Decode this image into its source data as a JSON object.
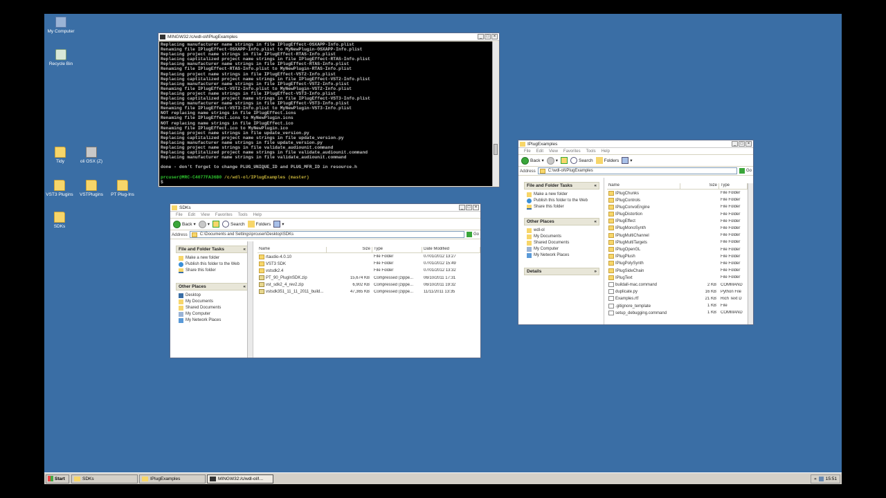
{
  "desktop": {
    "icons": [
      {
        "label": "My Computer",
        "icon": "computer-icon"
      },
      {
        "label": "Recycle Bin",
        "icon": "recycle-bin-icon"
      },
      {
        "label": "Tidy",
        "icon": "folder-icon"
      },
      {
        "label": "oli OSX (Z)",
        "icon": "network-drive-icon"
      },
      {
        "label": "VST3 Plugins",
        "icon": "folder-icon"
      },
      {
        "label": "VSTPlugins",
        "icon": "folder-icon"
      },
      {
        "label": "PT Plug-Ins",
        "icon": "folder-icon"
      },
      {
        "label": "SDKs",
        "icon": "folder-icon"
      }
    ]
  },
  "console": {
    "title": "MINGW32:/c/wdl-ol/IPlugExamples",
    "lines": [
      "Replacing manufacturer name strings in file IPlugEffect-OSXAPP-Info.plist",
      "Renaming file IPlugEffect-OSXAPP-Info.plist to MyNewPlugin-OSXAPP-Info.plist",
      "Replacing project name strings in file IPlugEffect-RTAS-Info.plist",
      "Replacing captitalized project name strings in file IPlugEffect-RTAS-Info.plist",
      "Replacing manufacturer name strings in file IPlugEffect-RTAS-Info.plist",
      "Renaming file IPlugEffect-RTAS-Info.plist to MyNewPlugin-RTAS-Info.plist",
      "Replacing project name strings in file IPlugEffect-VST2-Info.plist",
      "Replacing captitalized project name strings in file IPlugEffect-VST2-Info.plist",
      "Replacing manufacturer name strings in file IPlugEffect-VST2-Info.plist",
      "Renaming file IPlugEffect-VST2-Info.plist to MyNewPlugin-VST2-Info.plist",
      "Replacing project name strings in file IPlugEffect-VST3-Info.plist",
      "Replacing captitalized project name strings in file IPlugEffect-VST3-Info.plist",
      "Replacing manufacturer name strings in file IPlugEffect-VST3-Info.plist",
      "Renaming file IPlugEffect-VST3-Info.plist to MyNewPlugin-VST3-Info.plist",
      "NOT replacing name strings in file IPlugEffect.icns",
      "Renaming file IPlugEffect.icns to MyNewPlugin.icns",
      "NOT replacing name strings in file IPlugEffect.ico",
      "Renaming file IPlugEffect.ico to MyNewPlugin.ico",
      "Replacing project name strings in file update_version.py",
      "Replacing captitalized project name strings in file update_version.py",
      "Replacing manufacturer name strings in file update_version.py",
      "Replacing project name strings in file validate_audiounit.command",
      "Replacing captitalized project name strings in file validate_audiounit.command",
      "Replacing manufacturer name strings in file validate_audiounit.command",
      "",
      "done - don't forget to change PLUG_UNIQUE_ID and PLUG_MFR_ID in resource.h",
      ""
    ],
    "prompt_user": "prcuser@MRC-C4077FA36B0",
    "prompt_path": "/c/wdl-ol/IPlugExamples (master)",
    "prompt_symbol": "$"
  },
  "sdks_window": {
    "title": "SDKs",
    "menu": [
      "File",
      "Edit",
      "View",
      "Favorites",
      "Tools",
      "Help"
    ],
    "toolbar": {
      "back": "Back",
      "search": "Search",
      "folders": "Folders"
    },
    "address_label": "Address",
    "address": "C:\\Documents and Settings\\prcuser\\Desktop\\SDKs",
    "go": "Go",
    "tasks_header": "File and Folder Tasks",
    "tasks": [
      "Make a new folder",
      "Publish this folder to the Web",
      "Share this folder"
    ],
    "places_header": "Other Places",
    "places": [
      "Desktop",
      "My Documents",
      "Shared Documents",
      "My Computer",
      "My Network Places"
    ],
    "columns": [
      "Name",
      "Size",
      "Type",
      "Date Modified"
    ],
    "files": [
      {
        "name": "rtaudio-4.0.10",
        "size": "",
        "type": "File Folder",
        "date": "07/01/2012 13:27",
        "kind": "folder"
      },
      {
        "name": "VST3 SDK",
        "size": "",
        "type": "File Folder",
        "date": "07/01/2012 15:49",
        "kind": "folder"
      },
      {
        "name": "vstsdk2.4",
        "size": "",
        "type": "File Folder",
        "date": "07/01/2012 13:32",
        "kind": "folder"
      },
      {
        "name": "PT_90_PlugInSDK.zip",
        "size": "15,674 KB",
        "type": "Compressed (zippe...",
        "date": "06/10/2011 17:31",
        "kind": "zip"
      },
      {
        "name": "vst_sdk2_4_rev2.zip",
        "size": "6,902 KB",
        "type": "Compressed (zippe...",
        "date": "06/10/2011 19:32",
        "kind": "zip"
      },
      {
        "name": "vstsdk351_11_11_2011_build...",
        "size": "47,365 KB",
        "type": "Compressed (zippe...",
        "date": "11/11/2011 13:35",
        "kind": "zip"
      }
    ]
  },
  "iplug_window": {
    "title": "IPlugExamples",
    "menu": [
      "File",
      "Edit",
      "View",
      "Favorites",
      "Tools",
      "Help"
    ],
    "toolbar": {
      "back": "Back",
      "search": "Search",
      "folders": "Folders"
    },
    "address_label": "Address",
    "address": "C:\\wdl-ol\\IPlugExamples",
    "go": "Go",
    "tasks_header": "File and Folder Tasks",
    "tasks": [
      "Make a new folder",
      "Publish this folder to the Web",
      "Share this folder"
    ],
    "places_header": "Other Places",
    "places": [
      "wdl-ol",
      "My Documents",
      "Shared Documents",
      "My Computer",
      "My Network Places"
    ],
    "details_header": "Details",
    "columns": [
      "Name",
      "Size",
      "Type"
    ],
    "files": [
      {
        "name": "IPlugChunks",
        "size": "",
        "type": "File Folder",
        "kind": "folder"
      },
      {
        "name": "IPlugControls",
        "size": "",
        "type": "File Folder",
        "kind": "folder"
      },
      {
        "name": "IPlugConvoEngine",
        "size": "",
        "type": "File Folder",
        "kind": "folder"
      },
      {
        "name": "IPlugDistortion",
        "size": "",
        "type": "File Folder",
        "kind": "folder"
      },
      {
        "name": "IPlugEffect",
        "size": "",
        "type": "File Folder",
        "kind": "folder"
      },
      {
        "name": "IPlugMonoSynth",
        "size": "",
        "type": "File Folder",
        "kind": "folder"
      },
      {
        "name": "IPlugMultiChannel",
        "size": "",
        "type": "File Folder",
        "kind": "folder"
      },
      {
        "name": "IPlugMultiTargets",
        "size": "",
        "type": "File Folder",
        "kind": "folder"
      },
      {
        "name": "IPlugOpenGL",
        "size": "",
        "type": "File Folder",
        "kind": "folder"
      },
      {
        "name": "IPlugPlush",
        "size": "",
        "type": "File Folder",
        "kind": "folder"
      },
      {
        "name": "IPlugPolySynth",
        "size": "",
        "type": "File Folder",
        "kind": "folder"
      },
      {
        "name": "IPlugSideChain",
        "size": "",
        "type": "File Folder",
        "kind": "folder"
      },
      {
        "name": "IPlugText",
        "size": "",
        "type": "File Folder",
        "kind": "folder"
      },
      {
        "name": "buildall-mac.command",
        "size": "2 KB",
        "type": "COMMAND",
        "kind": "doc"
      },
      {
        "name": "duplicate.py",
        "size": "16 KB",
        "type": "Python File",
        "kind": "doc"
      },
      {
        "name": "Examples.rtf",
        "size": "21 KB",
        "type": "Rich Text D",
        "kind": "doc"
      },
      {
        "name": ".gitignore_template",
        "size": "1 KB",
        "type": "File",
        "kind": "doc"
      },
      {
        "name": "setup_debugging.command",
        "size": "1 KB",
        "type": "COMMAND",
        "kind": "doc"
      }
    ]
  },
  "taskbar": {
    "start": "Start",
    "buttons": [
      {
        "label": "SDKs",
        "active": false
      },
      {
        "label": "IPlugExamples",
        "active": false
      },
      {
        "label": "MINGW32:/c/wdl-ol/I...",
        "active": true
      }
    ],
    "clock": "15:51"
  },
  "colors": {
    "desktop": "#3a6ea5",
    "console_bg": "#000000",
    "prompt_green": "#2ec32e"
  }
}
